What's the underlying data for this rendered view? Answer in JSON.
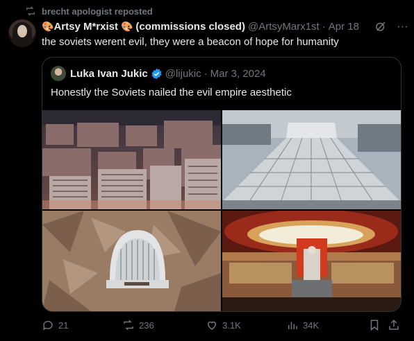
{
  "repost": {
    "text": "brecht apologist reposted",
    "icon": "repost-icon"
  },
  "tweet": {
    "display_name": "Artsy M*rxist",
    "name_suffix": "(commissions closed)",
    "emoji": "🎨",
    "handle": "@ArtsyMarx1st",
    "dot": "·",
    "date": "Apr 18",
    "text": "the soviets werent evil, they were a beacon of hope for humanity",
    "more_icon": "···"
  },
  "quote": {
    "display_name": "Luka Ivan Jukic",
    "handle": "@lijukic",
    "dot": "·",
    "date": "Mar 3, 2024",
    "text": "Honestly the Soviets nailed the evil empire aesthetic",
    "images": [
      {
        "name": "housing-blocks-photo"
      },
      {
        "name": "circus-dome-photo"
      },
      {
        "name": "mountain-monument-photo"
      },
      {
        "name": "lenin-hall-photo"
      }
    ]
  },
  "actions": {
    "replies": "21",
    "reposts": "236",
    "likes": "3.1K",
    "views": "34K"
  },
  "colors": {
    "background": "#000000",
    "text": "#e7e9ea",
    "muted": "#71767b",
    "border": "#2f3336",
    "verified": "#1d9bf0"
  }
}
